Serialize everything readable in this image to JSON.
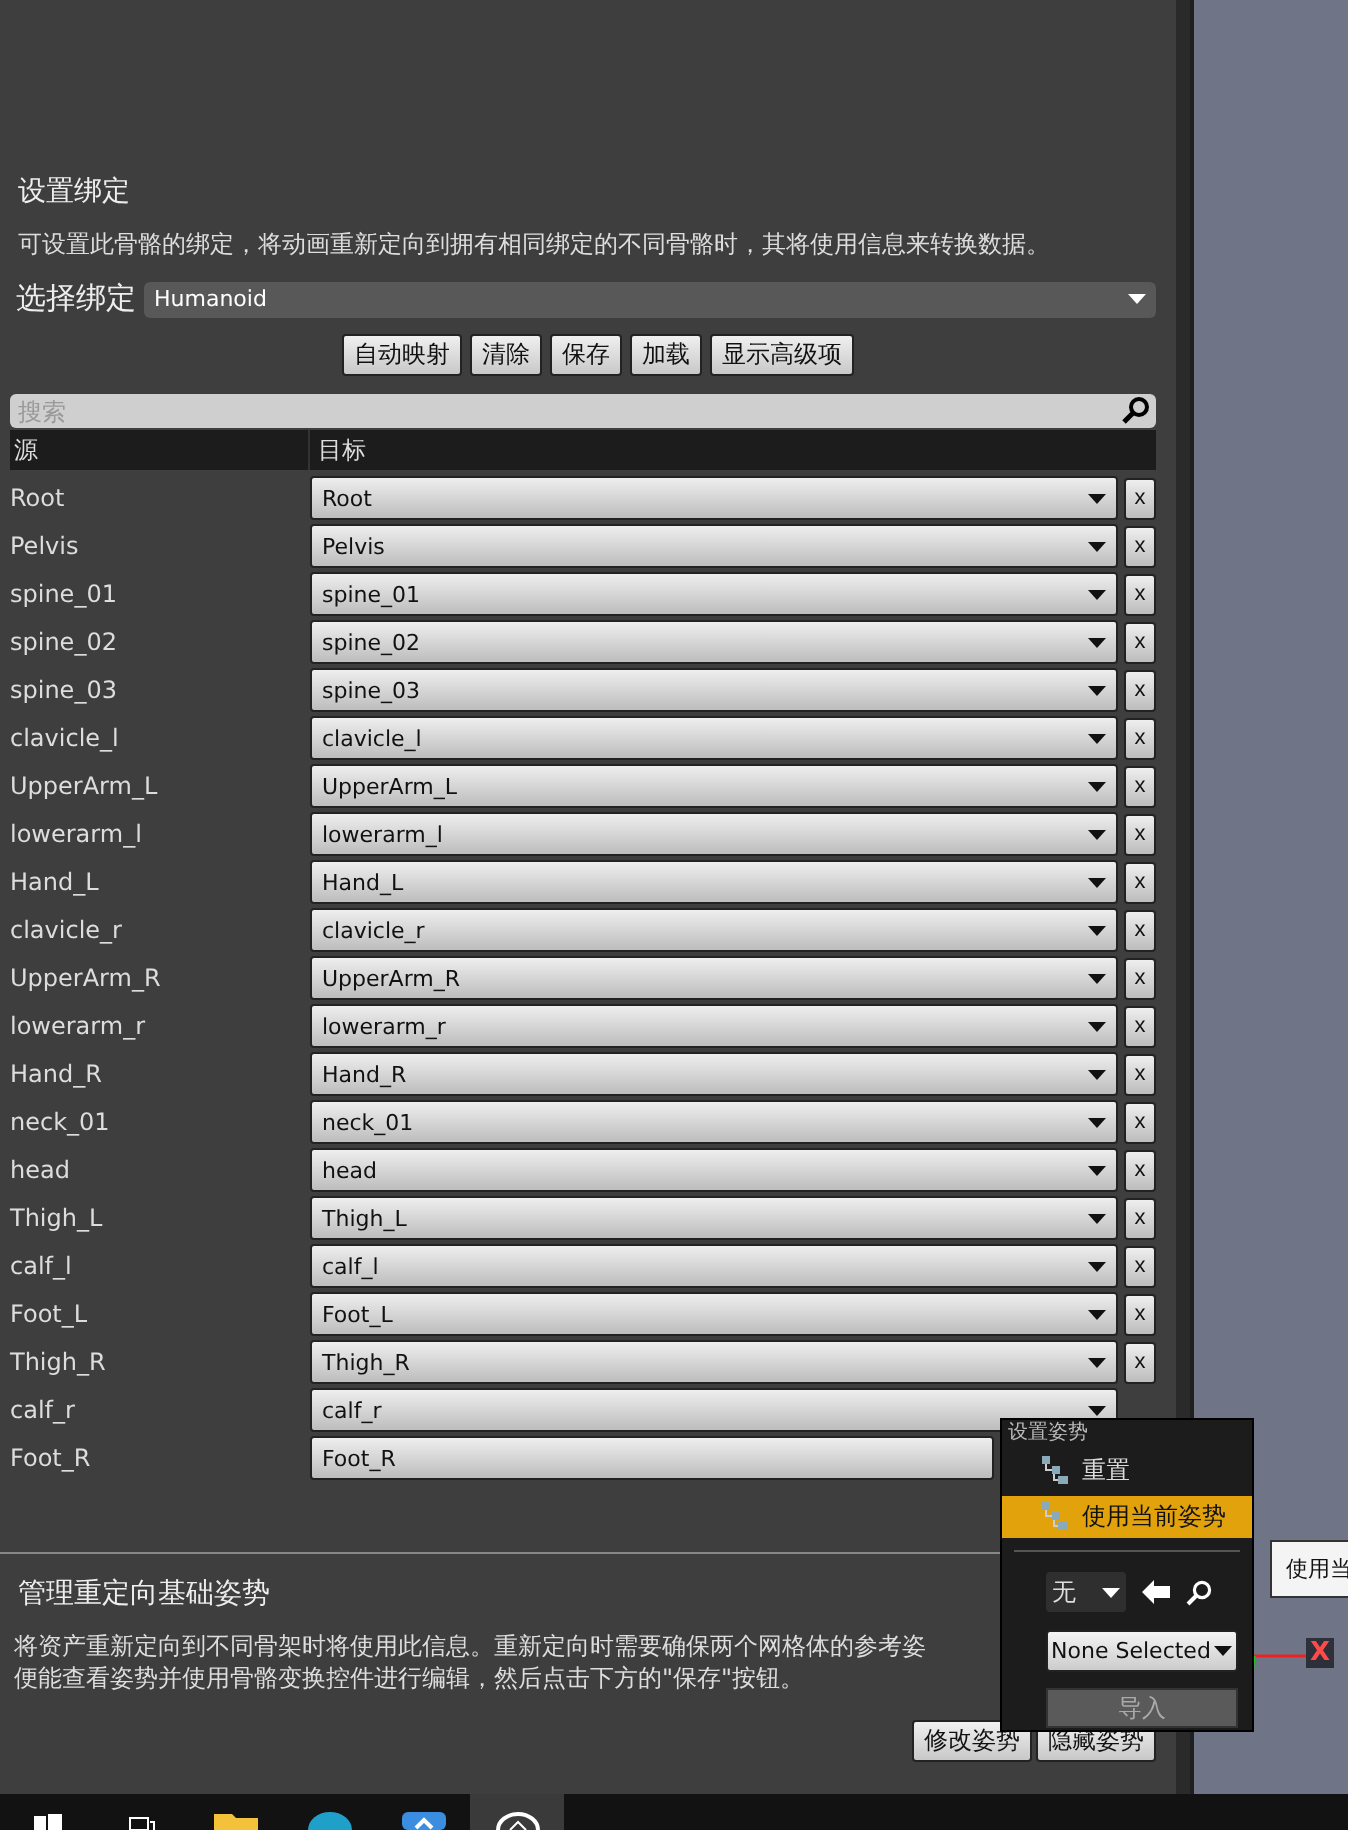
{
  "binding_section": {
    "title": "设置绑定",
    "description": "可设置此骨骼的绑定，将动画重新定向到拥有相同绑定的不同骨骼时，其将使用信息来转换数据。",
    "select_label": "选择绑定",
    "select_value": "Humanoid"
  },
  "toolbar_buttons": [
    "自动映射",
    "清除",
    "保存",
    "加载",
    "显示高级项"
  ],
  "search": {
    "placeholder": "搜索"
  },
  "table": {
    "columns": [
      "源",
      "目标"
    ],
    "rows": [
      {
        "source": "Root",
        "target": "Root",
        "clear": "x"
      },
      {
        "source": "Pelvis",
        "target": "Pelvis",
        "clear": "x"
      },
      {
        "source": "spine_01",
        "target": "spine_01",
        "clear": "x"
      },
      {
        "source": "spine_02",
        "target": "spine_02",
        "clear": "x"
      },
      {
        "source": "spine_03",
        "target": "spine_03",
        "clear": "x"
      },
      {
        "source": "clavicle_l",
        "target": "clavicle_l",
        "clear": "x"
      },
      {
        "source": "UpperArm_L",
        "target": "UpperArm_L",
        "clear": "x"
      },
      {
        "source": "lowerarm_l",
        "target": "lowerarm_l",
        "clear": "x"
      },
      {
        "source": "Hand_L",
        "target": "Hand_L",
        "clear": "x"
      },
      {
        "source": "clavicle_r",
        "target": "clavicle_r",
        "clear": "x"
      },
      {
        "source": "UpperArm_R",
        "target": "UpperArm_R",
        "clear": "x"
      },
      {
        "source": "lowerarm_r",
        "target": "lowerarm_r",
        "clear": "x"
      },
      {
        "source": "Hand_R",
        "target": "Hand_R",
        "clear": "x"
      },
      {
        "source": "neck_01",
        "target": "neck_01",
        "clear": "x"
      },
      {
        "source": "head",
        "target": "head",
        "clear": "x"
      },
      {
        "source": "Thigh_L",
        "target": "Thigh_L",
        "clear": "x"
      },
      {
        "source": "calf_l",
        "target": "calf_l",
        "clear": "x"
      },
      {
        "source": "Foot_L",
        "target": "Foot_L",
        "clear": "x"
      },
      {
        "source": "Thigh_R",
        "target": "Thigh_R",
        "clear": "x"
      },
      {
        "source": "calf_r",
        "target": "calf_r"
      },
      {
        "source": "Foot_R",
        "target": "Foot_R"
      }
    ]
  },
  "pose_section": {
    "title": "管理重定向基础姿势",
    "description_lines": [
      "将资产重新定向到不同骨架时将使用此信息。重新定向时需要确保两个网格体的参考姿",
      "便能查看姿势并使用骨骼变换控件进行编辑，然后点击下方的\"保存\"按钮。"
    ],
    "buttons": [
      "修改姿势",
      "隐藏姿势"
    ]
  },
  "pose_menu": {
    "title": "设置姿势",
    "items": [
      {
        "label": "重置",
        "selected": false
      },
      {
        "label": "使用当前姿势",
        "selected": true
      }
    ],
    "pose_combo": "无",
    "asset_combo": "None Selected",
    "import_button": "导入"
  },
  "viewport": {
    "tooltip": "使用当",
    "axis_label": "X"
  },
  "taskbar": {
    "apps": [
      {
        "kind": "windows",
        "selected": false
      },
      {
        "kind": "taskview",
        "selected": false
      },
      {
        "kind": "folder",
        "selected": false
      },
      {
        "kind": "edge",
        "selected": false
      },
      {
        "kind": "store",
        "selected": false
      },
      {
        "kind": "unreal",
        "selected": true
      }
    ]
  }
}
